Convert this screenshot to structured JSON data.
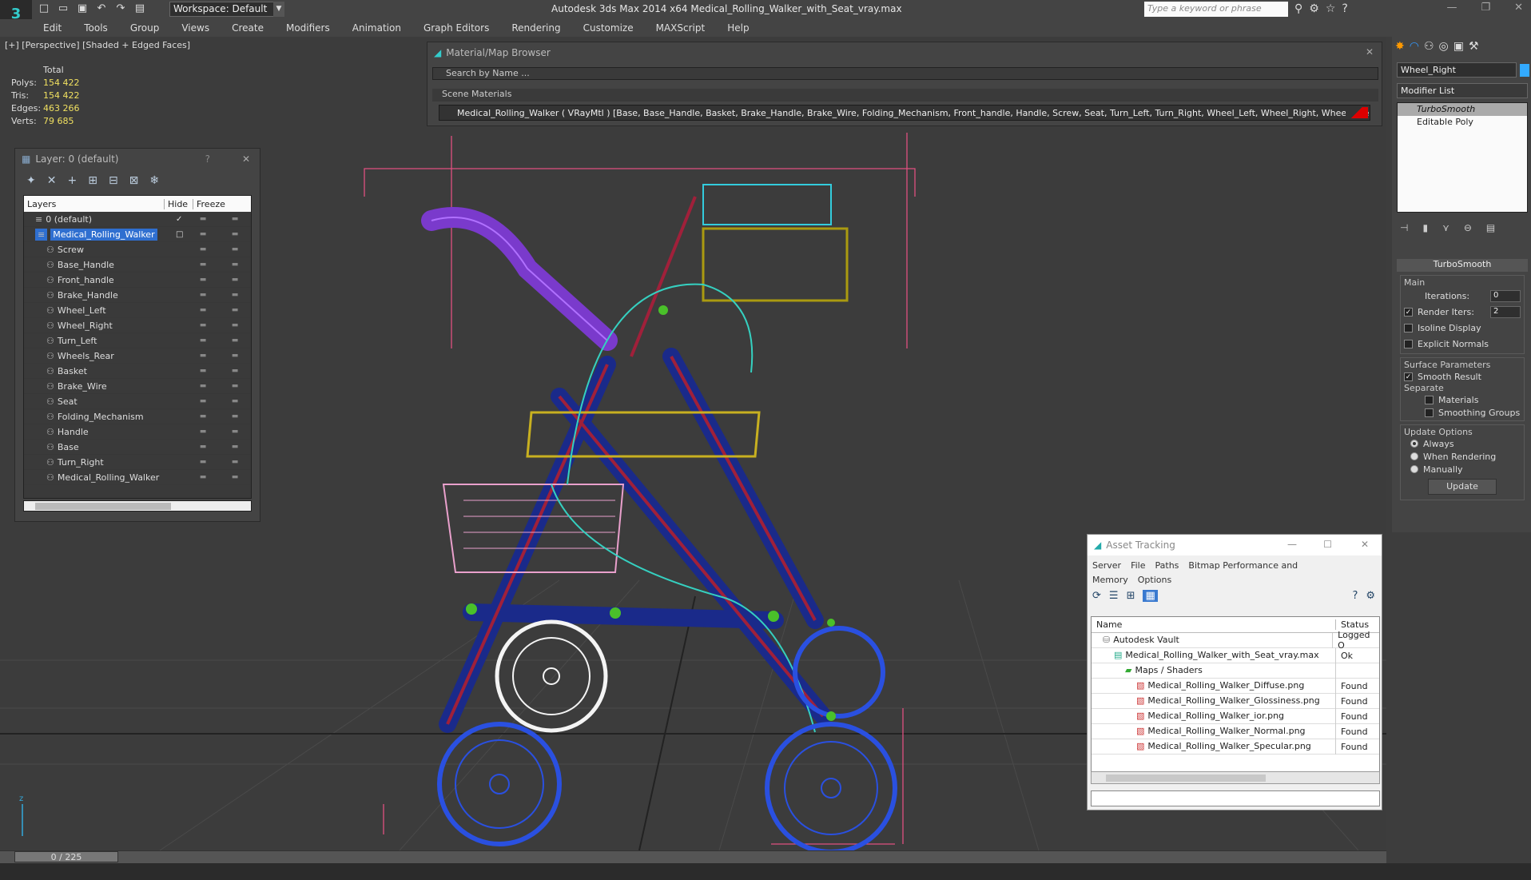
{
  "app": {
    "title": "Autodesk 3ds Max  2014 x64     Medical_Rolling_Walker_with_Seat_vray.max",
    "workspace": "Workspace: Default",
    "search_placeholder": "Type a keyword or phrase",
    "logo": "3"
  },
  "menu": [
    "Edit",
    "Tools",
    "Group",
    "Views",
    "Create",
    "Modifiers",
    "Animation",
    "Graph Editors",
    "Rendering",
    "Customize",
    "MAXScript",
    "Help"
  ],
  "viewport": {
    "label": "[+] [Perspective] [Shaded + Edged Faces]",
    "stats_header": "Total",
    "stats": [
      {
        "key": "Polys:",
        "value": "154 422"
      },
      {
        "key": "Tris:",
        "value": "154 422"
      },
      {
        "key": "Edges:",
        "value": "463 266"
      },
      {
        "key": "Verts:",
        "value": "79 685"
      }
    ]
  },
  "layer_panel": {
    "title": "Layer: 0 (default)",
    "help": "?",
    "close": "✕",
    "columns": {
      "name": "Layers",
      "hide": "Hide",
      "freeze": "Freeze"
    },
    "rows": [
      {
        "name": "0 (default)",
        "indent": 0,
        "selected": false
      },
      {
        "name": "Medical_Rolling_Walker",
        "indent": 0,
        "selected": true
      },
      {
        "name": "Screw",
        "indent": 1,
        "selected": false
      },
      {
        "name": "Base_Handle",
        "indent": 1,
        "selected": false
      },
      {
        "name": "Front_handle",
        "indent": 1,
        "selected": false
      },
      {
        "name": "Brake_Handle",
        "indent": 1,
        "selected": false
      },
      {
        "name": "Wheel_Left",
        "indent": 1,
        "selected": false
      },
      {
        "name": "Wheel_Right",
        "indent": 1,
        "selected": false
      },
      {
        "name": "Turn_Left",
        "indent": 1,
        "selected": false
      },
      {
        "name": "Wheels_Rear",
        "indent": 1,
        "selected": false
      },
      {
        "name": "Basket",
        "indent": 1,
        "selected": false
      },
      {
        "name": "Brake_Wire",
        "indent": 1,
        "selected": false
      },
      {
        "name": "Seat",
        "indent": 1,
        "selected": false
      },
      {
        "name": "Folding_Mechanism",
        "indent": 1,
        "selected": false
      },
      {
        "name": "Handle",
        "indent": 1,
        "selected": false
      },
      {
        "name": "Base",
        "indent": 1,
        "selected": false
      },
      {
        "name": "Turn_Right",
        "indent": 1,
        "selected": false
      },
      {
        "name": "Medical_Rolling_Walker",
        "indent": 1,
        "selected": false
      }
    ]
  },
  "material_browser": {
    "title": "Material/Map Browser",
    "search_placeholder": "Search by Name ...",
    "group": "Scene Materials",
    "material": "Medical_Rolling_Walker  ( VRayMtl )  [Base, Base_Handle, Basket, Brake_Handle, Brake_Wire, Folding_Mechanism, Front_handle, Handle, Screw, Seat, Turn_Left, Turn_Right, Wheel_Left, Wheel_Right, Wheels_Rear]"
  },
  "command_panel": {
    "object_name": "Wheel_Right",
    "modifier_list": "Modifier List",
    "stack": [
      "TurboSmooth",
      "Editable Poly"
    ],
    "rollout_title": "TurboSmooth",
    "main_group": "Main",
    "iterations_label": "Iterations:",
    "iterations_value": "0",
    "render_iters_label": "Render Iters:",
    "render_iters_value": "2",
    "isoline": "Isoline Display",
    "explicit_normals": "Explicit Normals",
    "surface_group": "Surface Parameters",
    "smooth_result": "Smooth Result",
    "separate": "Separate",
    "materials": "Materials",
    "smoothing_groups": "Smoothing Groups",
    "update_group": "Update Options",
    "always": "Always",
    "when_rendering": "When Rendering",
    "manually": "Manually",
    "update_button": "Update"
  },
  "asset_tracking": {
    "title": "Asset Tracking",
    "menu": [
      "Server",
      "File",
      "Paths",
      "Bitmap Performance and Memory",
      "Options"
    ],
    "columns": {
      "name": "Name",
      "status": "Status"
    },
    "rows": [
      {
        "name": "Autodesk Vault",
        "status": "Logged O",
        "indent": 1
      },
      {
        "name": "Medical_Rolling_Walker_with_Seat_vray.max",
        "status": "Ok",
        "indent": 2
      },
      {
        "name": "Maps / Shaders",
        "status": "",
        "indent": 3
      },
      {
        "name": "Medical_Rolling_Walker_Diffuse.png",
        "status": "Found",
        "indent": 4
      },
      {
        "name": "Medical_Rolling_Walker_Glossiness.png",
        "status": "Found",
        "indent": 4
      },
      {
        "name": "Medical_Rolling_Walker_ior.png",
        "status": "Found",
        "indent": 4
      },
      {
        "name": "Medical_Rolling_Walker_Normal.png",
        "status": "Found",
        "indent": 4
      },
      {
        "name": "Medical_Rolling_Walker_Specular.png",
        "status": "Found",
        "indent": 4
      }
    ]
  },
  "timeline": {
    "frame": "0 / 225"
  }
}
